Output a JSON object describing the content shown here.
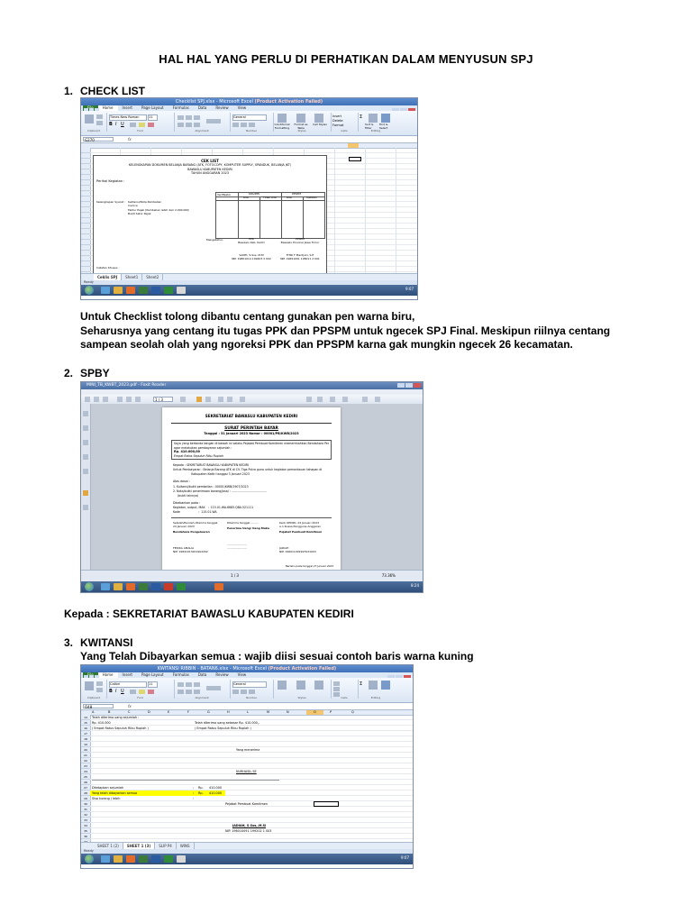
{
  "document": {
    "title": "HAL HAL YANG PERLU DI PERHATIKAN DALAM MENYUSUN SPJ",
    "sections": [
      {
        "num": "1.",
        "heading": "CHECK LIST"
      },
      {
        "num": "2.",
        "heading": "SPBY"
      },
      {
        "num": "3.",
        "heading": "KWITANSI",
        "subheading": "Yang Telah Dibayarkan semua : wajib diisi sesuai contoh baris warna kuning"
      }
    ],
    "checklist_notes": [
      "Untuk Checklist tolong dibantu centang gunakan pen warna biru,",
      "Seharusnya yang centang itu tugas  PPK dan PPSPM untuk ngecek SPJ Final. Meskipun riilnya centang",
      "sampean seolah olah yang ngoreksi PPK dan PPSPM karna gak mungkin ngecek 26 kecamatan."
    ],
    "kepada": "Kepada : SEKRETARIAT BAWASLU KABUPATEN KEDIRI"
  },
  "shot1": {
    "window_title_prefix": "Checklist SPJ.xlsx - Microsoft Excel",
    "window_title_suffix": "(Product Activation Failed)",
    "tabs": [
      "File",
      "Home",
      "Insert",
      "Page Layout",
      "Formulas",
      "Data",
      "Review",
      "View"
    ],
    "font_name": "Times New Roman",
    "font_size": "11",
    "number_format": "General",
    "ribbon_groups": [
      "Clipboard",
      "Font",
      "Alignment",
      "Number",
      "Styles",
      "Cells",
      "Editing"
    ],
    "style_buttons": [
      "Conditional Formatting",
      "Format as Table",
      "Cell Styles"
    ],
    "cell_buttons": [
      "Insert",
      "Delete",
      "Format"
    ],
    "edit_buttons": [
      "Sort & Filter",
      "Find & Select"
    ],
    "name_box": "G270",
    "doc_title": "CEK LIST",
    "doc_lines": [
      "KELENGKAPAN DOKUMEN BELANJA BARANG (ATK, FOTOCOPY, KOMPUTER SUPPLY, SPANDUK, BELANJA JKT)",
      "BAWASLU KABUPATEN KEDIRI",
      "TAHUN ANGGARAN 2023"
    ],
    "perihal": "Perihal Kegiatan :",
    "table_headers": [
      "Verifikator",
      "Ada",
      "Tidak Ada",
      "Ada",
      "Catatan"
    ],
    "group_headers": [
      "KPA/PPK",
      "PPSPM"
    ],
    "row_label": "Kelengkapan Syarat :",
    "items": [
      "Kwitansi/Nota Pembelian",
      "Invoice",
      "Faktur Pajak (Pembelian lebih dari 2.000.000)",
      "Bukti Setor Pajak"
    ],
    "mengetahui": "Mengetahui,",
    "ppk": "PPK",
    "ppk_role": "Bawaslu Kab. Kediri",
    "ppspm": "PPSPM",
    "ppspm_role": "Bawaslu Provinsi Jawa Timur",
    "ppk_name": "SANTI, S.Sos, M.M",
    "ppspm_name": "FITRI F Mardjuki, S.E",
    "ppk_nip": "NIP. 19801014 199403 2 002",
    "ppspm_nip": "NIP. 19691001 198011 2 001",
    "catatan": "Catatan Khusus :",
    "doc_title2": "CEK LIST",
    "sheet_tabs": [
      "Ceklis SPJ",
      "Sheet1",
      "Sheet2"
    ],
    "status": "Ready",
    "clock": "9:07"
  },
  "shot2": {
    "window_title": "MINI_TB_KWBT_2023.pdf - Foxit Reader",
    "page_box": "1 / 3",
    "org": "SEKRETARIAT BAWASLU KABUPATEN KEDIRI",
    "title": "SURAT PERINTAH BAYAR",
    "date_line": "Tanggal :  31 Januari 2023          Nomor : 00001/PB/KWB/2023",
    "intro": [
      "Saya yang bertanda tangan di bawah ini selaku Pejabat Pembuat Komitmen memerintahkan Bendahara Pengeluaran",
      "agar melakukan pembayaran sejumlah :"
    ],
    "amount": "Rp.  410.000,00",
    "terbilang": "Empat Ratus Sepuluh Ribu Rupiah",
    "fields": [
      "Kepada          :  SEKRETARIAT BAWASLU KABUPATEN KEDIRI",
      "Untuk Pembayaran :  Belanja Barang ATK di CV. Tiga Putra guna untuk kegiatan pemantauan tahapan di",
      "                    Kabupaten Kediri tanggal 3 Januari 2023"
    ],
    "atas_dasar": "Atas dasar :",
    "dasar_items": [
      "1.  Kuitansi/bukti pembelian          :  00001/KWB/1907/2023",
      "2.  Nota/bukti penerimaan barang/jasa/  :  .......................................",
      "     (bukti lainnya)"
    ],
    "dibebankan": "Dibebankan pada :",
    "keg": "Kegiatan, output, MAK   :  115.01.WA.6685.QBA.521111",
    "kode": "Kode                    :  115.01.WA",
    "sign_cols": [
      [
        "Setelah/Peroleh diterima tanggal",
        "24 Januari 2023",
        "Bendahara Pengeluaran",
        "FEDIKA AMALIA",
        "NIP. 19841013201902202"
      ],
      [
        "Diterima tanggal .........",
        "",
        "Penerima Uang/ Uang Muka",
        ".......................",
        "......................."
      ],
      [
        "Kedi, KEDIRI, 24 Januari 2023",
        "a.n Kuasa Pengguna Anggaran",
        "Pejabat Pembuat Komitmen",
        "JADIAH",
        "NIP. 196011091997021003"
      ]
    ],
    "footer_note": "Berlaku pada tanggal 27 Januari 2023",
    "zoom": "73.36%",
    "clock": "8:24"
  },
  "shot3": {
    "window_title_prefix": "KWITANSI RIBBIN - BATAN6.xlsx - Microsoft Excel",
    "window_title_suffix": "(Product Activation Failed)",
    "tabs": [
      "File",
      "Home",
      "Insert",
      "Page Layout",
      "Formulas",
      "Data",
      "Review",
      "View"
    ],
    "font_name": "Calibri",
    "font_size": "11",
    "number_format": "General",
    "ribbon_groups": [
      "Clipboard",
      "Font",
      "Alignment",
      "Number",
      "Styles",
      "Cells",
      "Editing"
    ],
    "name_box": "O48",
    "col_headers": [
      "A",
      "B",
      "C",
      "D",
      "E",
      "F",
      "G",
      "H",
      "L",
      "M",
      "N",
      "O",
      "P",
      "Q"
    ],
    "row_nums": [
      "14",
      "15",
      "16",
      "17",
      "18",
      "19",
      "20",
      "21",
      "22",
      "23",
      "24",
      "25",
      "26",
      "27",
      "28",
      "29",
      "30",
      "31",
      "32",
      "33",
      "34",
      "35",
      "36",
      "37"
    ],
    "left_lines": [
      "Telah diterima uang sejumlah :",
      "Rp.    410.000",
      "( Empat Ratus Sepuluh Ribu Rupiah )"
    ],
    "right_lines": [
      "Telah diterima uang sebesar Rp. 410.000,-",
      "( Empat Ratus Sepuluh Ribu Rupiah )"
    ],
    "yang_menerima": "Yang menerima",
    "recipient": "NURHASIL.SE",
    "summary": [
      {
        "label": "Ditetapkan sejumlah",
        "sep": ":",
        "cur": "Rp.",
        "val": "410.000",
        "yellow": false
      },
      {
        "label": "Yang telah dibayarkan semua",
        "sep": ":",
        "cur": "Rp.",
        "val": "410.000",
        "yellow": true
      },
      {
        "label": "Sisa kurang / lebih",
        "sep": ":",
        "cur": "",
        "val": "",
        "yellow": false
      }
    ],
    "ppk_label": "Pejabat Pembuat Komitmen",
    "ppk_name": "JADIAH, S.Sos,.M.SI",
    "ppk_nip": "NIP. 196010091 199202 1 003",
    "sheet_tabs": [
      "SHEET 1 (2)",
      "SHEET 1 (3)",
      "SLIP P4",
      "WINS"
    ],
    "status": "Ready",
    "clock": "9:07"
  }
}
